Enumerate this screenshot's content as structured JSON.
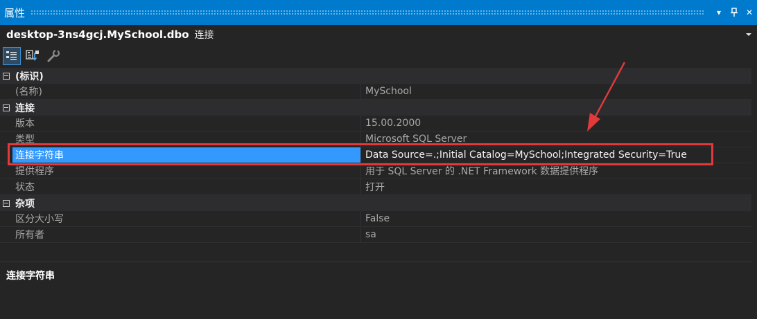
{
  "window": {
    "title": "属性",
    "menu_icon": "▾",
    "pin_icon": "pin-icon",
    "close_icon": "✕"
  },
  "object": {
    "name": "desktop-3ns4gcj.MySchool.dbo",
    "type": "连接"
  },
  "toolbar": {
    "buttons": [
      {
        "name": "categorized",
        "icon": "categorized-icon"
      },
      {
        "name": "alphabetical",
        "icon": "alphabetical-icon"
      },
      {
        "name": "property-pages",
        "icon": "wrench-icon"
      }
    ]
  },
  "grid": {
    "categories": [
      {
        "label": "(标识)",
        "props": [
          {
            "name": "(名称)",
            "value": "MySchool"
          }
        ]
      },
      {
        "label": "连接",
        "props": [
          {
            "name": "版本",
            "value": "15.00.2000"
          },
          {
            "name": "类型",
            "value": "Microsoft SQL Server"
          },
          {
            "name": "连接字符串",
            "value": "Data Source=.;Initial Catalog=MySchool;Integrated Security=True"
          },
          {
            "name": "提供程序",
            "value": "用于 SQL Server 的 .NET Framework 数据提供程序"
          },
          {
            "name": "状态",
            "value": "打开"
          }
        ]
      },
      {
        "label": "杂项",
        "props": [
          {
            "name": "区分大小写",
            "value": "False"
          },
          {
            "name": "所有者",
            "value": "sa"
          }
        ]
      }
    ]
  },
  "description": {
    "title": "连接字符串"
  },
  "colors": {
    "accent": "#007acc",
    "selection": "#3399ff",
    "annotation": "#e23a3a"
  }
}
